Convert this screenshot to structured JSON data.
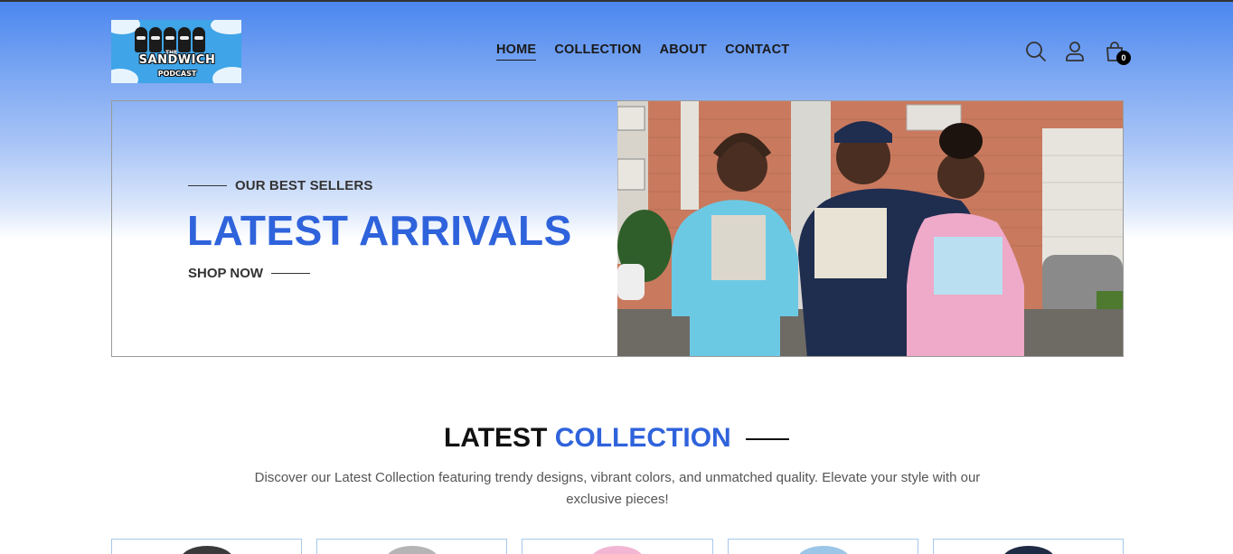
{
  "brand": {
    "logo_text": "SANDWICH",
    "logo_sub": "PODCAST",
    "logo_the": "THE"
  },
  "nav": {
    "items": [
      {
        "label": "HOME",
        "active": true
      },
      {
        "label": "COLLECTION",
        "active": false
      },
      {
        "label": "ABOUT",
        "active": false
      },
      {
        "label": "CONTACT",
        "active": false
      }
    ]
  },
  "header_icons": {
    "search": "search-icon",
    "account": "user-icon",
    "cart": "shopping-bag-icon",
    "cart_count": "0"
  },
  "hero": {
    "eyebrow": "OUR BEST SELLERS",
    "title": "LATEST ARRIVALS",
    "cta": "SHOP NOW",
    "accent_color": "#2f63dc"
  },
  "latest_collection": {
    "title_plain": "LATEST",
    "title_accent": "COLLECTION",
    "description": "Discover our Latest Collection featuring trendy designs, vibrant colors, and unmatched quality. Elevate your style with our exclusive pieces!"
  },
  "product_thumbs": [
    {
      "color": "#3a3a3a"
    },
    {
      "color": "#b5b5b5"
    },
    {
      "color": "#f2b6d4"
    },
    {
      "color": "#9cc6e8"
    },
    {
      "color": "#1f2a44"
    }
  ]
}
